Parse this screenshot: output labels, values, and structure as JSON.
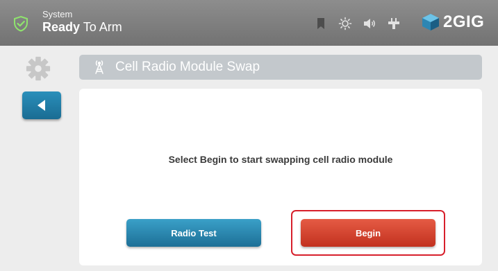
{
  "status": {
    "line1": "System",
    "line2_bold": "Ready",
    "line2_rest": " To Arm"
  },
  "status_icons": [
    "bookmark-icon",
    "brightness-icon",
    "volume-icon",
    "power-plug-icon"
  ],
  "brand": {
    "name": "2GIG",
    "color": "#3aa0c8"
  },
  "title_bar": {
    "text": "Cell Radio Module Swap",
    "icon": "cell-tower-icon"
  },
  "content": {
    "message": "Select Begin to start swapping cell radio module"
  },
  "buttons": {
    "radio_test": "Radio Test",
    "begin": "Begin"
  },
  "colors": {
    "accent_blue": "#1d6f96",
    "begin_red": "#c2311f",
    "highlight": "#d71f2b"
  }
}
